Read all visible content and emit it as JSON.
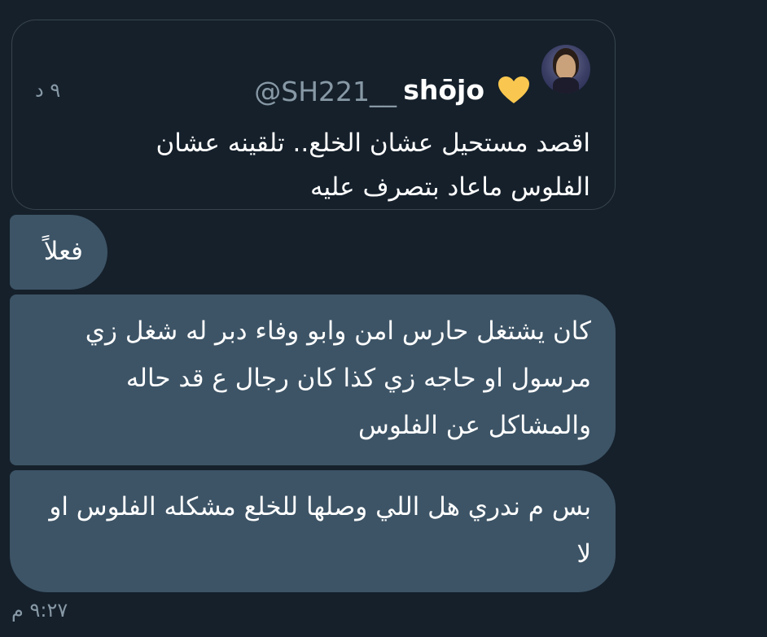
{
  "quoted_tweet": {
    "display_name": "shōjo",
    "handle": "@SH221__",
    "time": "٩ د",
    "text": "اقصد مستحيل عشان الخلع.. تلقينه عشان الفلوس ماعاد بتصرف عليه",
    "avatar_icon": "profile-photo",
    "heart_icon": "yellow-heart-emoji",
    "heart_color": "#f9c74f"
  },
  "messages": [
    {
      "text": "فعلاً"
    },
    {
      "text": "كان يشتغل حارس امن وابو وفاء دبر له شغل زي مرسول او حاجه زي كذا كان رجال ع قد حاله والمشاكل عن الفلوس"
    },
    {
      "text": "بس م ندري هل اللي وصلها للخلع مشكله الفلوس او لا"
    }
  ],
  "message_time": "٩:٢٧ م",
  "colors": {
    "background": "#15202b",
    "bubble": "#3d5466",
    "border": "#38444d",
    "muted_text": "#8899a6"
  }
}
